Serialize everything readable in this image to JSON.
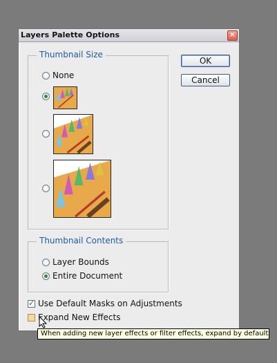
{
  "dialog": {
    "title": "Layers Palette Options",
    "close_icon": "close-icon",
    "buttons": {
      "ok": "OK",
      "cancel": "Cancel"
    }
  },
  "thumbnail_size": {
    "legend": "Thumbnail Size",
    "options": [
      {
        "label": "None",
        "selected": false
      },
      {
        "label": "",
        "selected": true,
        "size": "small"
      },
      {
        "label": "",
        "selected": false,
        "size": "medium"
      },
      {
        "label": "",
        "selected": false,
        "size": "large"
      }
    ]
  },
  "thumbnail_contents": {
    "legend": "Thumbnail Contents",
    "options": [
      {
        "label": "Layer Bounds",
        "selected": false
      },
      {
        "label": "Entire Document",
        "selected": true
      }
    ]
  },
  "checkboxes": [
    {
      "label": "Use Default Masks on Adjustments",
      "checked": true
    },
    {
      "label": "Expand New Effects",
      "checked": false
    }
  ],
  "tooltip": "When adding new layer effects or filter effects, expand by default",
  "colors": {
    "legend": "#1e5aa8",
    "selected_radio": "#2d8a2d",
    "thumb_bg": "#e8a94a"
  }
}
